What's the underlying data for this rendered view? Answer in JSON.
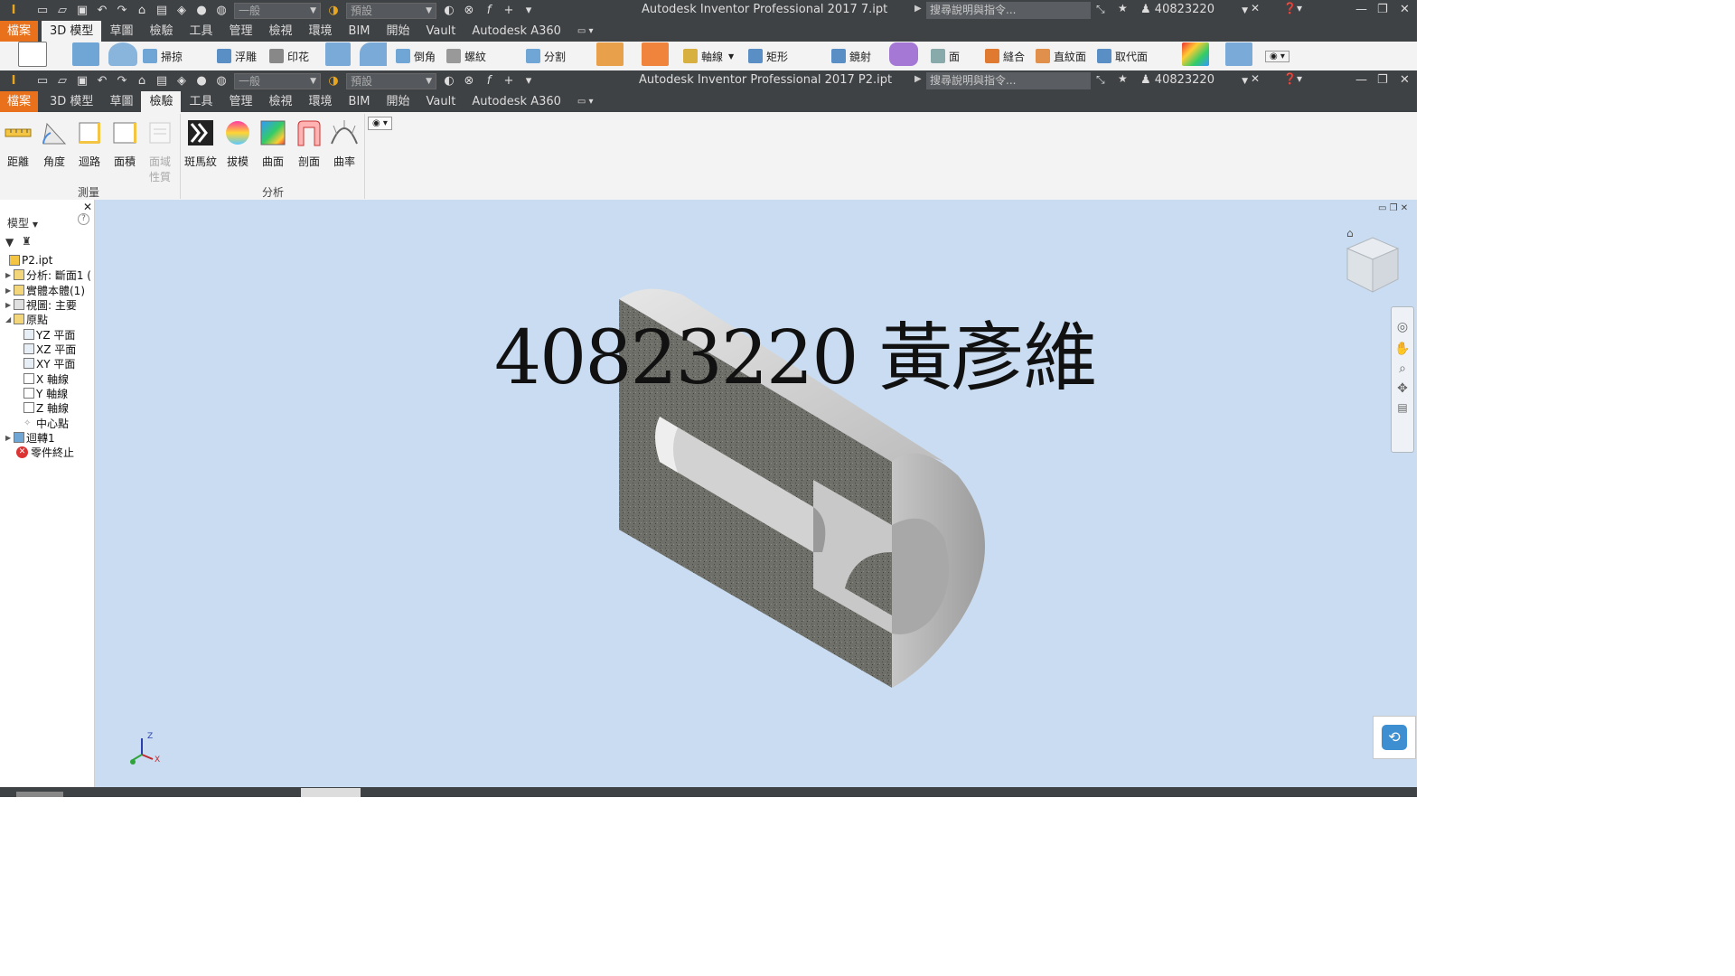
{
  "window1": {
    "title": "Autodesk Inventor Professional 2017    7.ipt",
    "appearance_combo": "一般",
    "material_combo": "預設",
    "search_placeholder": "搜尋說明與指令...",
    "user": "40823220"
  },
  "tabs1": [
    "檔案",
    "3D 模型",
    "草圖",
    "檢驗",
    "工具",
    "管理",
    "檢視",
    "環境",
    "BIM",
    "開始",
    "Vault",
    "Autodesk A360"
  ],
  "tabs1_active": "3D 模型",
  "ribbon1": {
    "sweep": "掃掠",
    "emboss": "浮雕",
    "decal": "印花",
    "chamfer": "倒角",
    "thread": "螺紋",
    "split": "分割",
    "axis": "軸線",
    "rectangle": "矩形",
    "mirror": "鏡射",
    "face": "面",
    "combine": "縫合",
    "ruled": "直紋面",
    "replace_face": "取代面"
  },
  "window2": {
    "title": "Autodesk Inventor Professional 2017    P2.ipt",
    "appearance_combo": "一般",
    "material_combo": "預設",
    "search_placeholder": "搜尋說明與指令...",
    "user": "40823220"
  },
  "tabs2": [
    "檔案",
    "3D 模型",
    "草圖",
    "檢驗",
    "工具",
    "管理",
    "檢視",
    "環境",
    "BIM",
    "開始",
    "Vault",
    "Autodesk A360"
  ],
  "tabs2_active": "檢驗",
  "ribbon2": {
    "distance": "距離",
    "angle": "角度",
    "loop": "迴路",
    "area": "面積",
    "region_props_1": "面域",
    "region_props_2": "性質",
    "zebra": "斑馬紋",
    "draft": "拔模",
    "surface": "曲面",
    "section": "剖面",
    "curvature": "曲率",
    "group_measure": "測量",
    "group_analysis": "分析"
  },
  "browser": {
    "header": "模型",
    "nodes": [
      "P2.ipt",
      "分析: 斷面1 (",
      "實體本體(1)",
      "視圖: 主要",
      "原點",
      "YZ 平面",
      "XZ 平面",
      "XY 平面",
      "X 軸線",
      "Y 軸線",
      "Z 軸線",
      "中心點",
      "迴轉1",
      "零件終止"
    ]
  },
  "viewport": {
    "watermark": "40823220 黃彥維"
  },
  "colors": {
    "titlebar": "#3f4245",
    "file_tab": "#e9711c",
    "ribbon": "#f3f3f3",
    "viewport": "#c9dcf1"
  }
}
